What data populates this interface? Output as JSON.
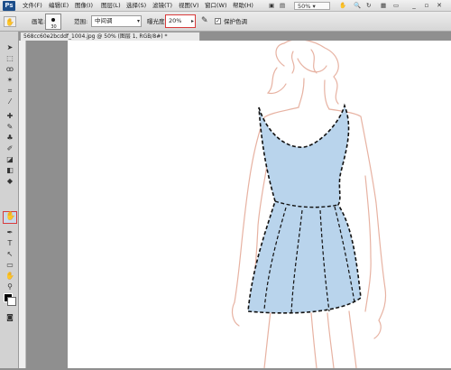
{
  "app": {
    "logo": "Ps"
  },
  "menu": [
    "文件(F)",
    "编辑(E)",
    "图像(I)",
    "图层(L)",
    "选择(S)",
    "滤镜(T)",
    "视图(V)",
    "窗口(W)",
    "帮助(H)"
  ],
  "menu_right": {
    "zoom": "50%"
  },
  "options": {
    "brush_label": "画笔:",
    "brush_size": "30",
    "range_label": "范围:",
    "range_value": "中间调",
    "exposure_label": "曝光度:",
    "exposure_value": "20%",
    "protect_tone": "保护色调"
  },
  "document": {
    "tab_title": "568cc60e2bcddf_1004.jpg @ 50% (图层 1, RGB/8#) *"
  },
  "colors": {
    "highlight": "#d83b3b",
    "dress_fill": "#b9d4ec",
    "sketch_line": "#e7b2a2"
  }
}
